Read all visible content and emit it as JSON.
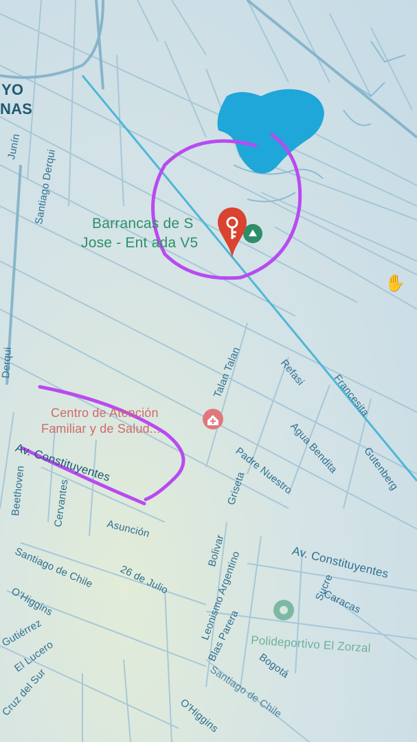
{
  "map": {
    "area_labels": [
      "YO",
      "NAS"
    ],
    "streets": [
      "Junín",
      "Santiago Derqui",
      "Derqui",
      "Talan Talan",
      "Refasi",
      "Francesita",
      "Agua Bendita",
      "Gutenberg",
      "Padre Nuestro",
      "Griseta",
      "Av. Constituyentes",
      "Beethoven",
      "Cervantes",
      "Asunción",
      "Bolivar",
      "Santiago de Chile",
      "26 de Julio",
      "O'Higgins",
      "Leonismo Argentino",
      "Sucre",
      "Caracas",
      "Av. Constituyentes",
      "Blas Parera",
      "Bogotá",
      "Santiago de Chile",
      "El Lucero",
      "Cruz del Sur",
      "O'Higgins",
      "Gutiérrez"
    ],
    "place_label_line1": "Barrancas de S",
    "place_label_line2": "Jose - Ent  ada V5",
    "poi_line1": "Centro de Atención",
    "poi_line2": "Familiar y de Salud...",
    "park_label": "Polideportivo El Zorzal",
    "pin_color": "#d9432f",
    "annotation_color": "#b84bf0",
    "water_color": "#1ea7d8",
    "route_color": "#46b4d6"
  }
}
